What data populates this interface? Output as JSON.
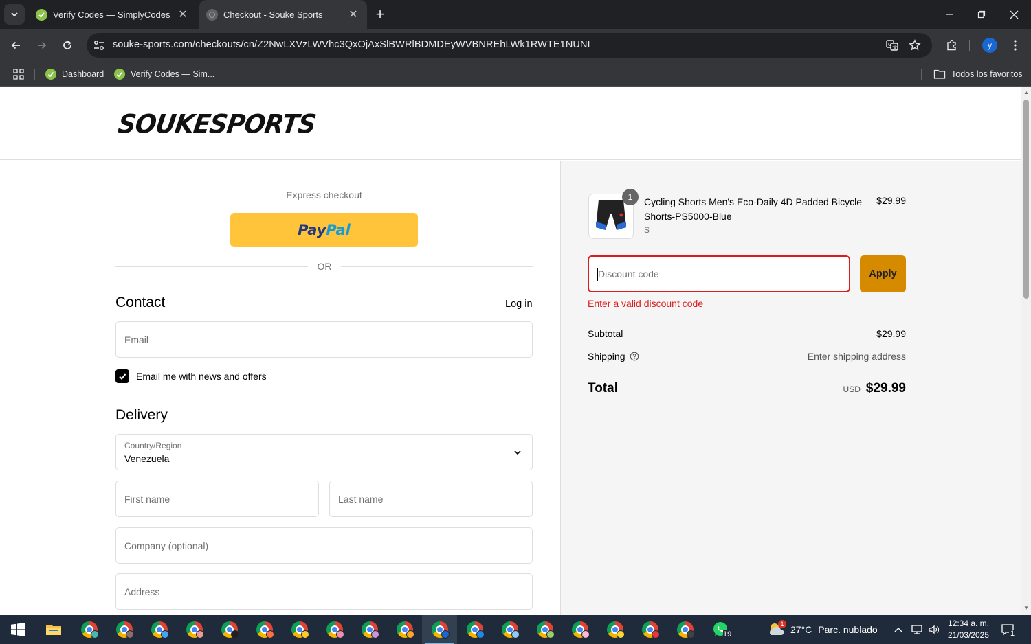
{
  "browser": {
    "tabs": [
      {
        "title": "Verify Codes — SimplyCodes",
        "active": false
      },
      {
        "title": "Checkout - Souke Sports",
        "active": true
      }
    ],
    "url": "souke-sports.com/checkouts/cn/Z2NwLXVzLWVhc3QxOjAxSlBWRlBDMDEyWVBNREhLWk1RWTE1NUNI",
    "profile_initial": "y",
    "bookmarks": [
      {
        "label": "Dashboard"
      },
      {
        "label": "Verify Codes — Sim..."
      }
    ],
    "all_bookmarks": "Todos los favoritos"
  },
  "store": {
    "logo_text": "SOUKESPORTS"
  },
  "checkout": {
    "express_label": "Express checkout",
    "paypal_pay": "Pay",
    "paypal_pal": "Pal",
    "or_label": "OR",
    "contact": {
      "heading": "Contact",
      "login_link": "Log in",
      "email_placeholder": "Email",
      "newsletter_label": "Email me with news and offers",
      "newsletter_checked": true
    },
    "delivery": {
      "heading": "Delivery",
      "country_label": "Country/Region",
      "country_value": "Venezuela",
      "first_name_placeholder": "First name",
      "last_name_placeholder": "Last name",
      "company_placeholder": "Company (optional)",
      "address_placeholder": "Address"
    }
  },
  "summary": {
    "item": {
      "quantity": "1",
      "name": "Cycling Shorts Men's Eco-Daily 4D Padded Bicycle Shorts-PS5000-Blue",
      "variant": "S",
      "price": "$29.99"
    },
    "discount_placeholder": "Discount code",
    "apply_label": "Apply",
    "discount_error": "Enter a valid discount code",
    "subtotal_label": "Subtotal",
    "subtotal_value": "$29.99",
    "shipping_label": "Shipping",
    "shipping_value": "Enter shipping address",
    "total_label": "Total",
    "total_currency": "USD",
    "total_value": "$29.99"
  },
  "taskbar": {
    "weather_temp": "27°C",
    "weather_desc": "Parc. nublado",
    "weather_badge": "1",
    "whatsapp_badge": "19",
    "time": "12:34 a. m.",
    "date": "21/03/2025",
    "notification_count": "1"
  },
  "colors": {
    "error": "#dd1d1d",
    "apply_button": "#d68a00",
    "paypal_button": "#ffc439",
    "summary_bg": "#f5f5f5"
  }
}
